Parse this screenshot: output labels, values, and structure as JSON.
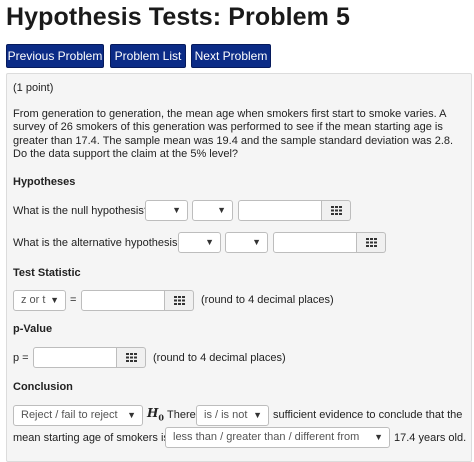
{
  "title": "Hypothesis Tests: Problem 5",
  "nav": {
    "previous": "Previous Problem",
    "list": "Problem List",
    "next": "Next Problem"
  },
  "points": "(1 point)",
  "problem_text": "From generation to generation, the mean age when smokers first start to smoke varies. A survey of 26 smokers of this generation was performed to see if the mean starting age is greater than 17.4. The sample mean was 19.4 and the sample standard deviation was 2.8. Do the data support the claim at the 5% level?",
  "hypotheses": {
    "heading": "Hypotheses",
    "null_label": "What is the null hypothesis?",
    "alt_label": "What is the alternative hypothesis?"
  },
  "test_statistic": {
    "heading": "Test Statistic",
    "select_value": "z or t",
    "equals": "=",
    "hint": "(round to 4 decimal places)"
  },
  "p_value": {
    "heading": "p-Value",
    "label": "p =",
    "hint": "(round to 4 decimal places)"
  },
  "conclusion": {
    "heading": "Conclusion",
    "reject_select": "Reject / fail to reject",
    "h0_symbol": "H",
    "h0_sub": "0",
    "there": "There",
    "is_select": "is / is not",
    "text1": "sufficient evidence to conclude that the",
    "text2": "mean starting age of smokers is",
    "comparison_select": "less than / greater than / different from",
    "text3": "17.4 years old."
  },
  "colors": {
    "nav_button": "#0b2b86",
    "panel_bg": "#f5f5f5"
  },
  "icons": {
    "dropdown": "caret-down",
    "keyboard": "keyboard-grid"
  }
}
